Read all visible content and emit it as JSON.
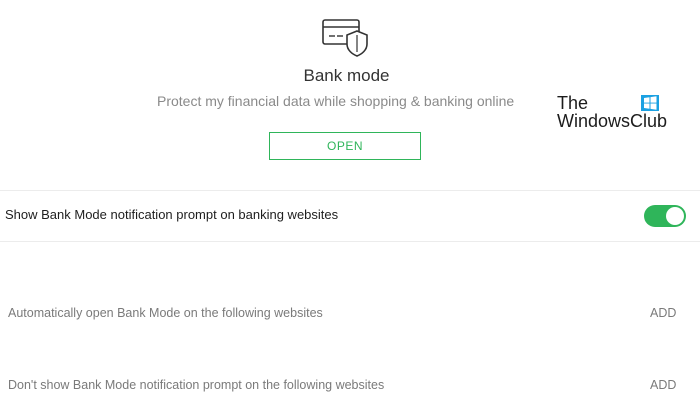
{
  "hero": {
    "icon": "card-shield-icon",
    "title": "Bank mode",
    "subtitle": "Protect my financial data while shopping & banking online",
    "open_label": "OPEN"
  },
  "watermark": {
    "line1": "The",
    "line2": "WindowsClub",
    "logo_icon": "windows-logo-icon"
  },
  "notification_toggle": {
    "label": "Show Bank Mode notification prompt on banking websites",
    "enabled": true
  },
  "auto_open_list": {
    "label": "Automatically open Bank Mode on the following websites",
    "add_label": "ADD"
  },
  "exclusion_list": {
    "label": "Don't show Bank Mode notification prompt on the following websites",
    "add_label": "ADD"
  },
  "colors": {
    "accent_green": "#2fb55a",
    "text_dark": "#1e1e1e",
    "text_muted": "#7a7a7a",
    "watermark_blue": "#1ba1e2"
  }
}
